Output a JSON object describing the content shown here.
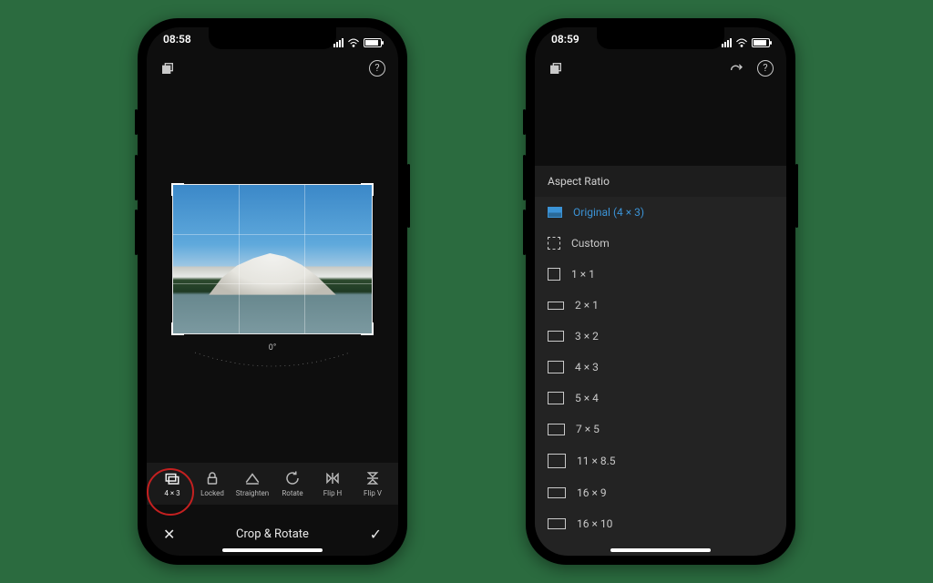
{
  "left": {
    "status_time": "08:58",
    "angle_label": "0°",
    "toolbar": [
      {
        "key": "aspect",
        "label": "4 × 3"
      },
      {
        "key": "locked",
        "label": "Locked"
      },
      {
        "key": "straighten",
        "label": "Straighten"
      },
      {
        "key": "rotate",
        "label": "Rotate"
      },
      {
        "key": "fliph",
        "label": "Flip H"
      },
      {
        "key": "flipv",
        "label": "Flip V"
      }
    ],
    "bottom_title": "Crop & Rotate"
  },
  "right": {
    "status_time": "08:59",
    "panel_title": "Aspect Ratio",
    "items": [
      {
        "label": "Original (4 × 3)",
        "cls": "rb-orig",
        "selected": true
      },
      {
        "label": "Custom",
        "cls": "rb-custom"
      },
      {
        "label": "1 × 1",
        "cls": "rb-1x1"
      },
      {
        "label": "2 × 1",
        "cls": "rb-2x1"
      },
      {
        "label": "3 × 2",
        "cls": "rb-3x2"
      },
      {
        "label": "4 × 3",
        "cls": "rb-4x3"
      },
      {
        "label": "5 × 4",
        "cls": "rb-5x4"
      },
      {
        "label": "7 × 5",
        "cls": "rb-7x5"
      },
      {
        "label": "11 × 8.5",
        "cls": "rb-11x85"
      },
      {
        "label": "16 × 9",
        "cls": "rb-16x9"
      },
      {
        "label": "16 × 10",
        "cls": "rb-16x10"
      }
    ]
  }
}
